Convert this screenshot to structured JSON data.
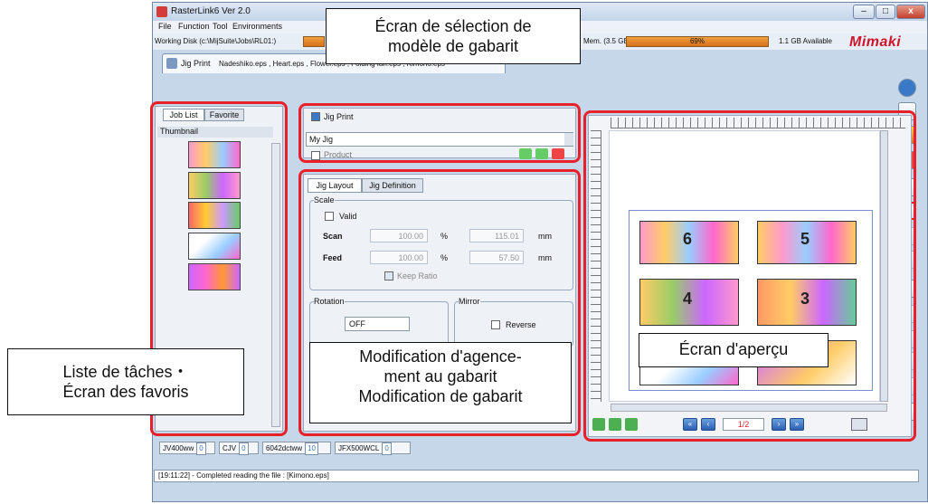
{
  "window": {
    "title": "RasterLink6 Ver 2.0",
    "close": "x",
    "minimize": "–",
    "maximize": "□"
  },
  "menu": [
    "File",
    "Function",
    "Tool",
    "Environments"
  ],
  "disk": {
    "working": "Working Disk (c:\\MijSuite\\Jobs\\RL01:)",
    "mem": "Mem. (3.5 GB)",
    "mem_pct": "69%",
    "available": "1.1 GB Available",
    "logo": "Mimaki"
  },
  "job_tab": {
    "label": "Jig Print",
    "files": "Nadeshiko.eps , Heart.eps , Flower.eps , Folding fan.eps , Kimono.eps"
  },
  "left_panel": {
    "tabs": [
      "Job List",
      "Favorite"
    ],
    "column": "Thumbnail"
  },
  "jig": {
    "print_label": "Jig Print",
    "select_value": "My Jig",
    "product_label": "Product"
  },
  "layout_tabs": [
    "Jig Layout",
    "Jig Definition"
  ],
  "scale": {
    "group": "Scale",
    "valid": "Valid",
    "scan_label": "Scan",
    "scan_pct": "100.00",
    "scan_mm": "115.01",
    "feed_label": "Feed",
    "feed_pct": "100.00",
    "feed_mm": "57.50",
    "pct_unit": "%",
    "mm_unit": "mm",
    "keep_ratio": "Keep Ratio"
  },
  "rotation": {
    "group": "Rotation",
    "value": "OFF"
  },
  "mirror": {
    "group": "Mirror",
    "reverse": "Reverse"
  },
  "preview": {
    "page": "1/2",
    "numbers": [
      "6",
      "5",
      "4",
      "3"
    ]
  },
  "printers": [
    {
      "name": "JV400ww",
      "count": "0"
    },
    {
      "name": "CJV",
      "count": "0"
    },
    {
      "name": "6042dctww",
      "count": "10"
    },
    {
      "name": "JFX500WCL",
      "count": "0"
    }
  ],
  "log": "[19:11:22] - Completed reading the file : [Kimono.eps]",
  "callouts": {
    "template": [
      "Écran de sélection de",
      "modèle de gabarit"
    ],
    "joblist": [
      "Liste de tâches・",
      "Écran des favoris"
    ],
    "layout": [
      "Modification d'agence-",
      "ment au gabarit",
      "Modification de gabarit"
    ],
    "preview": "Écran d'aperçu"
  },
  "colors": {
    "highlight": "#e8202a",
    "accent": "#d0142b"
  }
}
